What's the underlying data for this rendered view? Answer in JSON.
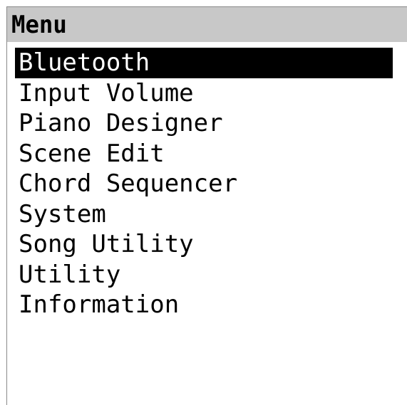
{
  "title": "Menu",
  "menu": {
    "selected_index": 0,
    "items": [
      {
        "label": "Bluetooth"
      },
      {
        "label": "Input Volume"
      },
      {
        "label": "Piano Designer"
      },
      {
        "label": "Scene Edit"
      },
      {
        "label": "Chord Sequencer"
      },
      {
        "label": "System"
      },
      {
        "label": "Song Utility"
      },
      {
        "label": "Utility"
      },
      {
        "label": "Information"
      }
    ]
  }
}
